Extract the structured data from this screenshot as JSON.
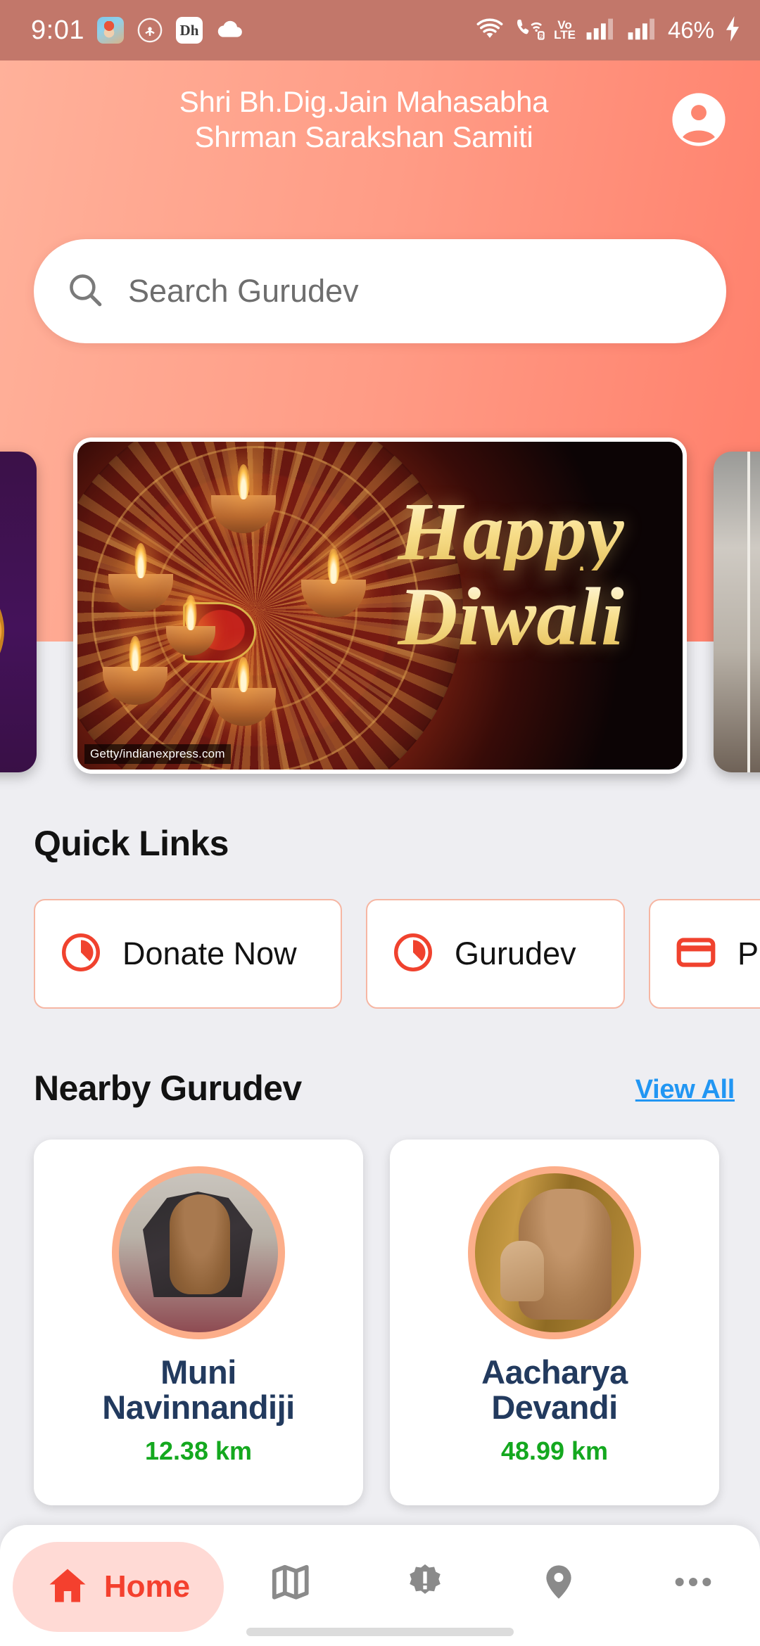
{
  "status_bar": {
    "time": "9:01",
    "left_icons": [
      "game-app-icon",
      "broadcast-icon",
      "dh-app-icon",
      "cloud-icon"
    ],
    "right_icons": [
      "wifi-icon",
      "vowifi-call-icon",
      "volte-icon",
      "signal-sim1-icon",
      "signal-sim2-icon"
    ],
    "volte_line1": "Vo",
    "volte_line2": "LTE",
    "battery_percent": "46%",
    "charging": true
  },
  "header": {
    "title_line1": "Shri Bh.Dig.Jain Mahasabha",
    "title_line2": "Shrman Sarakshan Samiti",
    "profile_icon": "account-circle-icon",
    "gradient_from": "#ffb19a",
    "gradient_to": "#ff7f6b"
  },
  "search": {
    "placeholder": "Search Gurudev",
    "icon": "search-icon"
  },
  "carousel": {
    "slides": [
      {
        "id": "prev",
        "alt": "purple-gold-banner"
      },
      {
        "id": "active",
        "alt": "Happy Diwali banner",
        "headline_line1": "Happy",
        "headline_line2": "Diwali",
        "credit": "Getty/indianexpress.com"
      },
      {
        "id": "next",
        "alt": "interior-photo-banner"
      }
    ]
  },
  "quick_links": {
    "title": "Quick Links",
    "items": [
      {
        "label": "Donate Now",
        "icon": "donate-pie-icon"
      },
      {
        "label": "Gurudev",
        "icon": "donate-pie-icon"
      },
      {
        "label": "P",
        "icon": "credit-card-icon"
      }
    ]
  },
  "nearby": {
    "title": "Nearby Gurudev",
    "view_all": "View All",
    "cards": [
      {
        "name_line1": "Muni",
        "name_line2": "Navinnandiji",
        "distance": "12.38 km",
        "avatar": "muni-navinnandiji-photo"
      },
      {
        "name_line1": "Aacharya",
        "name_line2": "Devandi",
        "distance": "48.99 km",
        "avatar": "aacharya-devandi-photo"
      }
    ]
  },
  "bottom_nav": {
    "items": [
      {
        "label": "Home",
        "icon": "home-icon",
        "active": true
      },
      {
        "label": "",
        "icon": "map-icon",
        "active": false
      },
      {
        "label": "",
        "icon": "alert-badge-icon",
        "active": false
      },
      {
        "label": "",
        "icon": "location-pin-icon",
        "active": false
      },
      {
        "label": "",
        "icon": "more-horizontal-icon",
        "active": false
      }
    ],
    "active_color": "#f4402e",
    "active_pill_color": "#ffdad5",
    "inactive_color": "#8a8a8a"
  },
  "colors": {
    "accent_red": "#f4402e",
    "distance_green": "#14a81f",
    "link_blue": "#2196f3",
    "page_bg": "#eeeef2"
  }
}
